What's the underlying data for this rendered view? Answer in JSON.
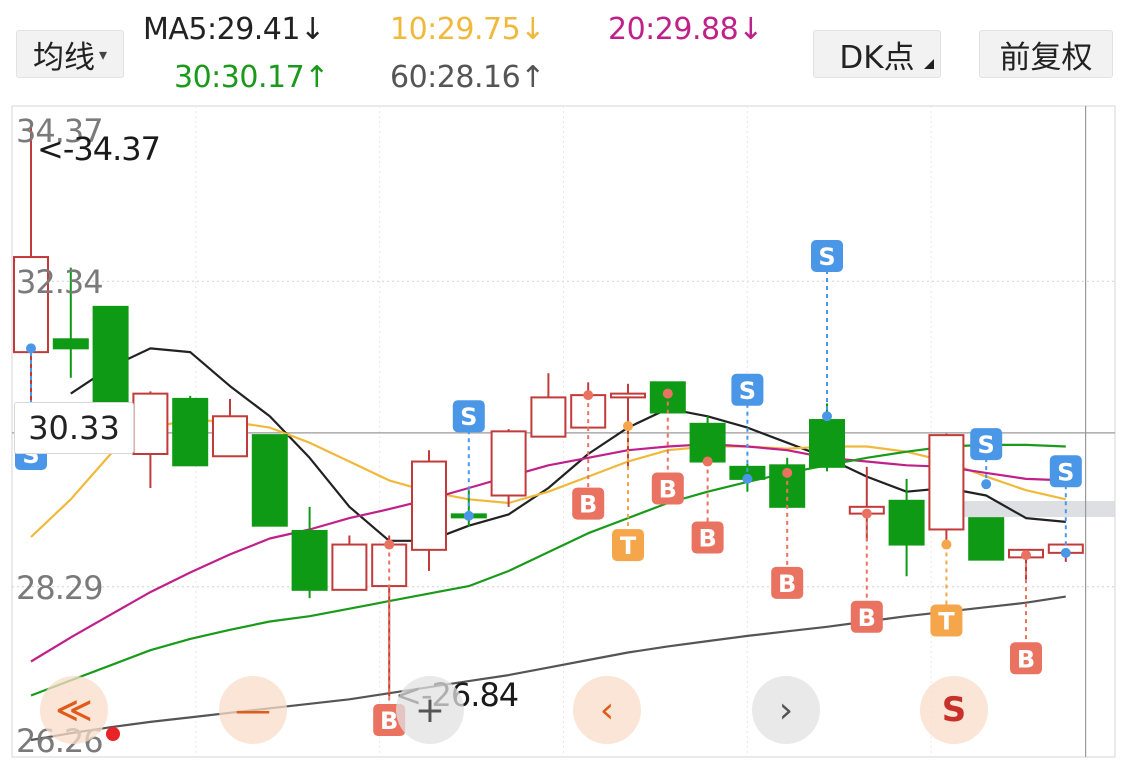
{
  "header": {
    "ma_select": {
      "label": "均线",
      "arrow": "▾"
    },
    "ma_values": {
      "ma5": {
        "text": "MA5:29.41↓",
        "color": "#222222"
      },
      "ma10": {
        "text": "10:29.75↓",
        "color": "#f0b93c"
      },
      "ma20": {
        "text": "20:29.88↓",
        "color": "#c0208a"
      },
      "ma30": {
        "text": "30:30.17↑",
        "color": "#1a9a1a"
      },
      "ma60": {
        "text": "60:28.16↑",
        "color": "#555555"
      }
    },
    "dk_button": {
      "label": "DK点"
    },
    "adjust_button": {
      "label": "前复权"
    }
  },
  "price_box": {
    "value": "30.33"
  },
  "nav_buttons": [
    {
      "name": "fast-back-button",
      "glyph": "≪",
      "active": true
    },
    {
      "name": "zoom-out-button",
      "glyph": "—",
      "active": true
    },
    {
      "name": "zoom-in-button",
      "glyph": "+",
      "active": false
    },
    {
      "name": "prev-button",
      "glyph": "‹",
      "active": true
    },
    {
      "name": "next-button",
      "glyph": "›",
      "active": false
    },
    {
      "name": "signal-switch-button",
      "glyph": "S",
      "active": true
    }
  ],
  "chart_data": {
    "type": "candlestick",
    "ylim": [
      26.26,
      34.37
    ],
    "y_ticks": [
      34.37,
      32.34,
      28.29,
      26.26
    ],
    "y_tick_labels": [
      "34.37",
      "32.34",
      "28.29",
      "26.26"
    ],
    "max_annotation": {
      "index": 0,
      "value": 34.37,
      "label": "<-34.37"
    },
    "min_annotation": {
      "index": 9,
      "value": 26.84,
      "label": "<-26.84"
    },
    "crosshair": {
      "index": 27,
      "price": 30.33
    },
    "colors": {
      "up": "#c23a3a",
      "down": "#0e9a14",
      "signal_b": "#ea7260",
      "signal_s": "#4a97e8",
      "signal_t": "#f5a54a"
    },
    "candles": [
      {
        "o": 31.4,
        "h": 34.37,
        "l": 30.72,
        "c": 32.66
      },
      {
        "o": 31.57,
        "h": 32.52,
        "l": 31.06,
        "c": 31.45
      },
      {
        "o": 32.0,
        "h": 32.0,
        "l": 30.6,
        "c": 30.6
      },
      {
        "o": 30.05,
        "h": 30.88,
        "l": 29.6,
        "c": 30.85
      },
      {
        "o": 30.78,
        "h": 30.82,
        "l": 29.9,
        "c": 29.9
      },
      {
        "o": 30.02,
        "h": 30.78,
        "l": 30.02,
        "c": 30.55
      },
      {
        "o": 30.3,
        "h": 30.3,
        "l": 29.1,
        "c": 29.1
      },
      {
        "o": 29.03,
        "h": 29.35,
        "l": 28.14,
        "c": 28.25
      },
      {
        "o": 28.25,
        "h": 28.97,
        "l": 28.25,
        "c": 28.85
      },
      {
        "o": 28.3,
        "h": 28.97,
        "l": 26.84,
        "c": 28.85
      },
      {
        "o": 28.78,
        "h": 30.1,
        "l": 28.5,
        "c": 29.95
      },
      {
        "o": 29.25,
        "h": 29.57,
        "l": 29.09,
        "c": 29.23
      },
      {
        "o": 29.5,
        "h": 30.38,
        "l": 29.35,
        "c": 30.35
      },
      {
        "o": 30.28,
        "h": 31.12,
        "l": 30.28,
        "c": 30.8
      },
      {
        "o": 30.4,
        "h": 31.0,
        "l": 30.4,
        "c": 30.83
      },
      {
        "o": 30.8,
        "h": 30.98,
        "l": 29.85,
        "c": 30.85
      },
      {
        "o": 31.0,
        "h": 31.0,
        "l": 30.6,
        "c": 30.6
      },
      {
        "o": 30.45,
        "h": 30.55,
        "l": 29.95,
        "c": 29.95
      },
      {
        "o": 29.88,
        "h": 29.92,
        "l": 29.55,
        "c": 29.72
      },
      {
        "o": 29.9,
        "h": 30.0,
        "l": 29.35,
        "c": 29.35
      },
      {
        "o": 30.5,
        "h": 30.72,
        "l": 29.82,
        "c": 29.88
      },
      {
        "o": 29.26,
        "h": 29.88,
        "l": 28.9,
        "c": 29.35
      },
      {
        "o": 29.43,
        "h": 29.72,
        "l": 28.43,
        "c": 28.85
      },
      {
        "o": 29.05,
        "h": 30.32,
        "l": 28.85,
        "c": 30.3
      },
      {
        "o": 29.2,
        "h": 29.2,
        "l": 28.65,
        "c": 28.65
      },
      {
        "o": 28.68,
        "h": 28.78,
        "l": 28.35,
        "c": 28.78
      },
      {
        "o": 28.74,
        "h": 28.84,
        "l": 28.62,
        "c": 28.85
      }
    ],
    "series": [
      {
        "key": "ma5",
        "color": "#222222",
        "values": [
          null,
          30.85,
          31.2,
          31.45,
          31.4,
          30.95,
          30.55,
          30.0,
          29.35,
          28.9,
          28.9,
          29.1,
          29.25,
          29.6,
          30.05,
          30.4,
          30.65,
          30.55,
          30.4,
          30.2,
          30.0,
          29.75,
          29.55,
          29.6,
          29.5,
          29.2,
          29.15
        ]
      },
      {
        "key": "ma10",
        "color": "#f0b93c",
        "values": [
          28.95,
          29.45,
          30.05,
          30.4,
          30.5,
          30.48,
          30.4,
          30.2,
          29.95,
          29.7,
          29.55,
          29.45,
          29.4,
          29.55,
          29.75,
          29.95,
          30.1,
          30.15,
          30.15,
          30.12,
          30.15,
          30.15,
          30.08,
          29.95,
          29.75,
          29.57,
          29.45
        ]
      },
      {
        "key": "ma20",
        "color": "#c0208a",
        "values": [
          27.3,
          27.62,
          27.92,
          28.22,
          28.48,
          28.72,
          28.93,
          29.05,
          29.2,
          29.32,
          29.45,
          29.6,
          29.75,
          29.9,
          30.0,
          30.1,
          30.15,
          30.18,
          30.15,
          30.1,
          30.0,
          29.95,
          29.9,
          29.88,
          29.8,
          29.72,
          29.7
        ]
      },
      {
        "key": "ma30",
        "color": "#1a9a1a",
        "values": [
          26.85,
          27.05,
          27.25,
          27.45,
          27.6,
          27.72,
          27.83,
          27.9,
          28.0,
          28.1,
          28.2,
          28.3,
          28.5,
          28.75,
          29.0,
          29.2,
          29.4,
          29.55,
          29.68,
          29.8,
          29.9,
          30.0,
          30.08,
          30.15,
          30.17,
          30.17,
          30.15
        ]
      },
      {
        "key": "ma60",
        "color": "#555555",
        "values": [
          26.26,
          26.35,
          26.43,
          26.5,
          26.56,
          26.62,
          26.68,
          26.74,
          26.8,
          26.88,
          26.96,
          27.04,
          27.12,
          27.22,
          27.32,
          27.42,
          27.5,
          27.57,
          27.64,
          27.7,
          27.76,
          27.83,
          27.9,
          27.96,
          28.02,
          28.08,
          28.16
        ]
      }
    ],
    "signals": [
      {
        "index": 0,
        "type": "S",
        "price": 31.45,
        "label": "S",
        "stem_color": "#4a97e8"
      },
      {
        "index": 9,
        "type": "B",
        "price": 28.85,
        "label": "B",
        "stem_color": "#ea7260"
      },
      {
        "index": 11,
        "type": "S",
        "price": 29.23,
        "label": "S",
        "stem_color": "#4a97e8"
      },
      {
        "index": 14,
        "type": "B",
        "price": 30.83,
        "label": "B",
        "stem_color": "#ea7260"
      },
      {
        "index": 15,
        "type": "T",
        "price": 30.42,
        "label": "T",
        "stem_color": "#f5a54a"
      },
      {
        "index": 16,
        "type": "B",
        "price": 30.85,
        "label": "B",
        "stem_color": "#ea7260"
      },
      {
        "index": 17,
        "type": "B",
        "price": 29.95,
        "label": "B",
        "stem_color": "#ea7260"
      },
      {
        "index": 18,
        "type": "S",
        "price": 29.72,
        "label": "S",
        "stem_color": "#4a97e8"
      },
      {
        "index": 19,
        "type": "B",
        "price": 29.8,
        "label": "B",
        "stem_color": "#ea7260"
      },
      {
        "index": 20,
        "type": "S",
        "price": 30.55,
        "label": "S",
        "stem_color": "#4a97e8"
      },
      {
        "index": 21,
        "type": "B",
        "price": 29.26,
        "label": "B",
        "stem_color": "#ea7260"
      },
      {
        "index": 23,
        "type": "T",
        "price": 28.85,
        "label": "T",
        "stem_color": "#f5a54a"
      },
      {
        "index": 24,
        "type": "S",
        "price": 29.65,
        "label": "S",
        "stem_color": "#4a97e8"
      },
      {
        "index": 25,
        "type": "B",
        "price": 28.71,
        "label": "B",
        "stem_color": "#ea7260"
      },
      {
        "index": 26,
        "type": "S",
        "price": 28.74,
        "label": "S",
        "stem_color": "#4a97e8"
      }
    ]
  }
}
